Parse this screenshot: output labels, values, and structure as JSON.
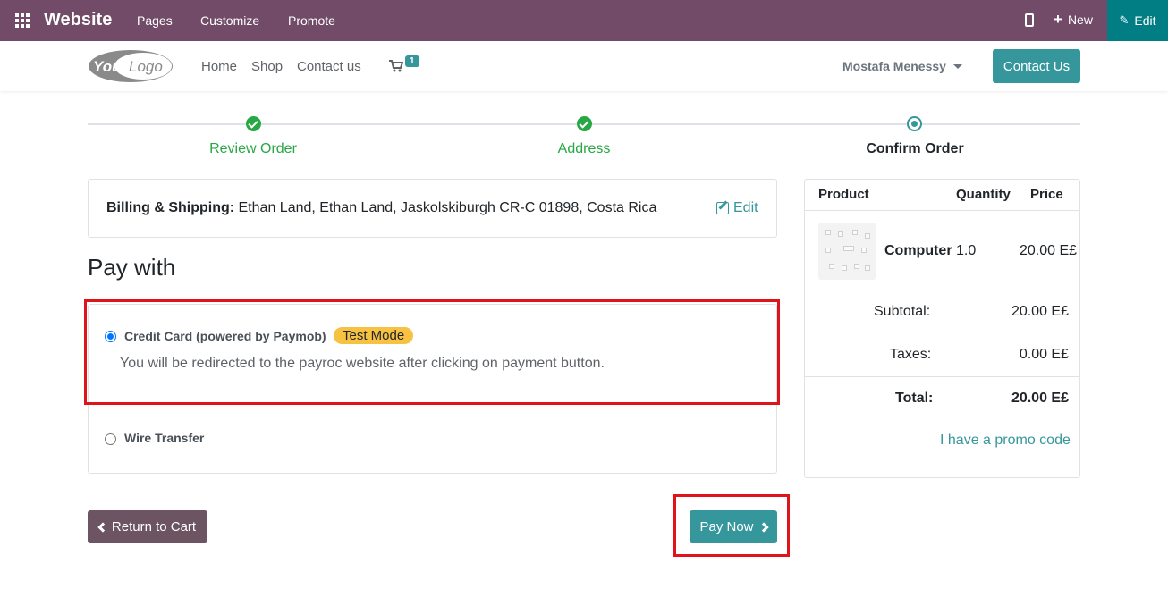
{
  "topbar": {
    "brand": "Website",
    "menu": [
      "Pages",
      "Customize",
      "Promote"
    ],
    "new_label": "New",
    "edit_label": "Edit"
  },
  "header": {
    "logo_text": "YourLogo",
    "nav": [
      "Home",
      "Shop",
      "Contact us"
    ],
    "cart_count": "1",
    "user": "Mostafa Menessy",
    "contact_button": "Contact Us"
  },
  "wizard": {
    "steps": [
      {
        "label": "Review Order",
        "status": "done"
      },
      {
        "label": "Address",
        "status": "done"
      },
      {
        "label": "Confirm Order",
        "status": "current"
      }
    ]
  },
  "billing": {
    "label": "Billing & Shipping:",
    "address": " Ethan Land, Ethan Land, Jaskolskiburgh CR-C 01898, Costa Rica",
    "edit_label": "Edit"
  },
  "payment": {
    "title": "Pay with",
    "options": [
      {
        "label": "Credit Card (powered by Paymob)",
        "badge": "Test Mode",
        "selected": true,
        "description": "You will be redirected to the payroc website after clicking on payment button."
      },
      {
        "label": "Wire Transfer",
        "selected": false
      }
    ]
  },
  "actions": {
    "return_label": "Return to Cart",
    "pay_label": "Pay Now"
  },
  "summary": {
    "headers": {
      "product": "Product",
      "quantity": "Quantity",
      "price": "Price"
    },
    "items": [
      {
        "name": "Computer",
        "quantity": "1.0",
        "price": "20.00 E£"
      }
    ],
    "subtotal_label": "Subtotal:",
    "subtotal": "20.00 E£",
    "taxes_label": "Taxes:",
    "taxes": "0.00 E£",
    "total_label": "Total:",
    "total": "20.00 E£",
    "promo_label": "I have a promo code"
  },
  "colors": {
    "topbar": "#714b67",
    "primary": "#35979c",
    "success": "#28a745",
    "highlight": "#e0131a",
    "badge": "#f7c142"
  }
}
